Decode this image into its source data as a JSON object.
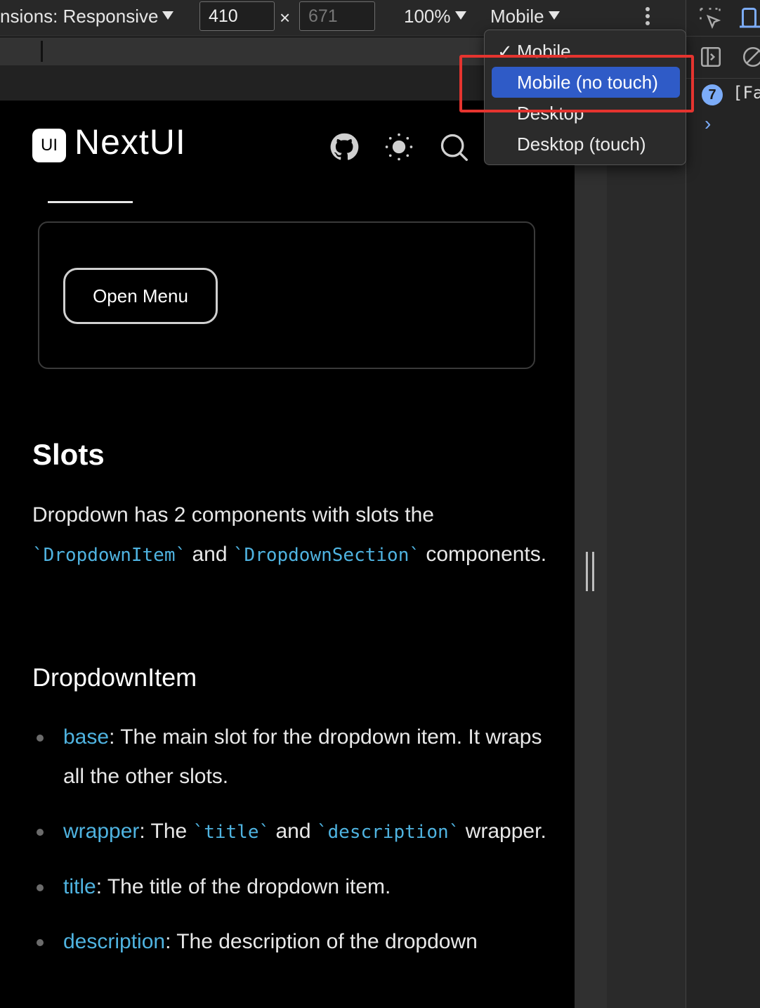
{
  "toolbar": {
    "dimensions_label": "nsions: Responsive",
    "width_value": "410",
    "height_value": "671",
    "times": "×",
    "zoom_label": "100%",
    "device_label": "Mobile"
  },
  "device_menu": {
    "items": [
      {
        "label": "Mobile",
        "checked": true
      },
      {
        "label": "Mobile (no touch)",
        "highlighted": true
      },
      {
        "label": "Desktop"
      },
      {
        "label": "Desktop (touch)"
      }
    ],
    "check_mark": "✓"
  },
  "devtools": {
    "badge_count": "7",
    "console_text": "[Fa",
    "chevron": "›"
  },
  "page": {
    "logo_text": "UI",
    "brand": "NextUI",
    "open_menu_label": "Open Menu",
    "slots_heading": "Slots",
    "intro": {
      "part1": "Dropdown has 2 components with slots the ",
      "code1": "`DropdownItem`",
      "part2": " and ",
      "code2": "`DropdownSection`",
      "part3": " components."
    },
    "dropdown_item_heading": "DropdownItem",
    "slots": [
      {
        "term": "base",
        "text": ": The main slot for the dropdown item. It wraps all the other slots."
      },
      {
        "term": "wrapper",
        "text_a": ": The ",
        "code_a": "`title`",
        "text_b": " and ",
        "code_b": "`description`",
        "text_c": " wrapper."
      },
      {
        "term": "title",
        "text": ": The title of the dropdown item."
      },
      {
        "term": "description",
        "text": ": The description of the dropdown"
      }
    ]
  },
  "colors": {
    "accent": "#4fb3e0",
    "menu_selected": "#2f5bc7",
    "highlight": "#e5342f"
  }
}
